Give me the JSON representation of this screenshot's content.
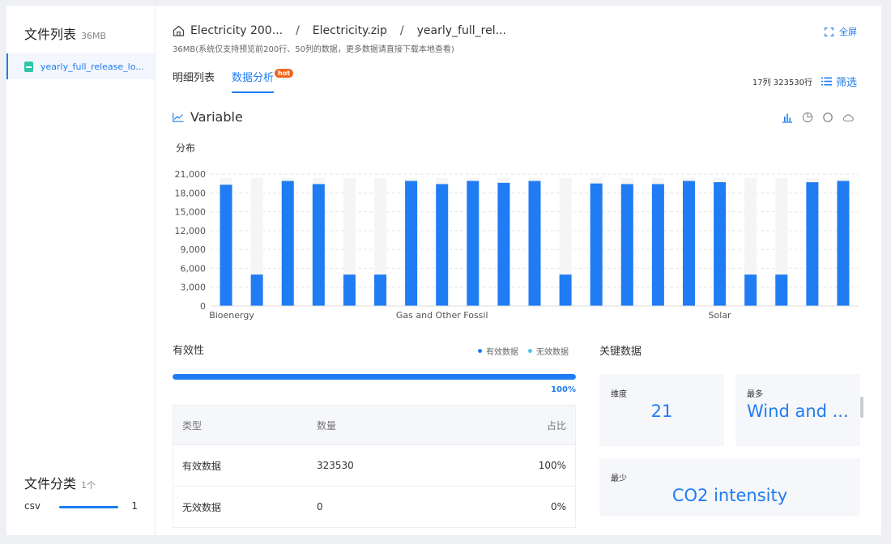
{
  "sidebar": {
    "title": "文件列表",
    "size": "36MB",
    "file_name": "yearly_full_release_lo...",
    "category_title": "文件分类",
    "category_count": "1个",
    "categories": [
      {
        "label": "csv",
        "count": "1",
        "fill": 1.0
      }
    ]
  },
  "header": {
    "crumbs": [
      "Electricity 200...",
      "Electricity.zip",
      "yearly_full_rel..."
    ],
    "sub_info": "36MB(系统仅支持预览前200行、50列的数据，更多数据请直接下载本地查看)",
    "fullscreen_label": "全屏"
  },
  "tabs": [
    {
      "label": "明细列表",
      "active": false
    },
    {
      "label": "数据分析",
      "active": true,
      "badge": "hot"
    }
  ],
  "meta": {
    "dims": "17列 323530行",
    "filter_label": "筛选"
  },
  "variable": {
    "title": "Variable",
    "dist_label": "分布",
    "icons": [
      "bar-chart-icon",
      "pie-chart-icon",
      "circle-chart-icon",
      "cloud-icon"
    ]
  },
  "chart_data": {
    "type": "bar",
    "categories": [
      "Bioenergy",
      "",
      "",
      "",
      "",
      "",
      "",
      "Gas and Other Fossil",
      "",
      "",
      "",
      "",
      "",
      "",
      "",
      "",
      "Solar",
      "",
      "",
      "",
      ""
    ],
    "values": [
      19300,
      5000,
      19900,
      19400,
      5000,
      5000,
      19900,
      19400,
      19900,
      19600,
      19900,
      5000,
      19500,
      19400,
      19400,
      19900,
      19700,
      5000,
      5000,
      19700,
      19900
    ],
    "ylim": [
      0,
      21000
    ],
    "yticks": [
      "0",
      "3,000",
      "6,000",
      "9,000",
      "12,000",
      "15,000",
      "18,000",
      "21,000"
    ],
    "grid": true,
    "bar_color": "#1f7cf2",
    "background_color": "#f5f5f6"
  },
  "validity": {
    "title": "有效性",
    "legend": [
      {
        "label": "有效数据",
        "color": "#1f7cf2"
      },
      {
        "label": "无效数据",
        "color": "#52c2f0"
      }
    ],
    "percent": "100%",
    "fill": 1.0,
    "columns": [
      "类型",
      "数量",
      "占比"
    ],
    "rows": [
      [
        "有效数据",
        "323530",
        "100%"
      ],
      [
        "无效数据",
        "0",
        "0%"
      ]
    ]
  },
  "key_data": {
    "title": "关键数据",
    "dimension_label": "维度",
    "dimension_value": "21",
    "most_label": "最多",
    "most_value": "Wind and ...",
    "least_label": "最少",
    "least_value": "CO2 intensity"
  }
}
